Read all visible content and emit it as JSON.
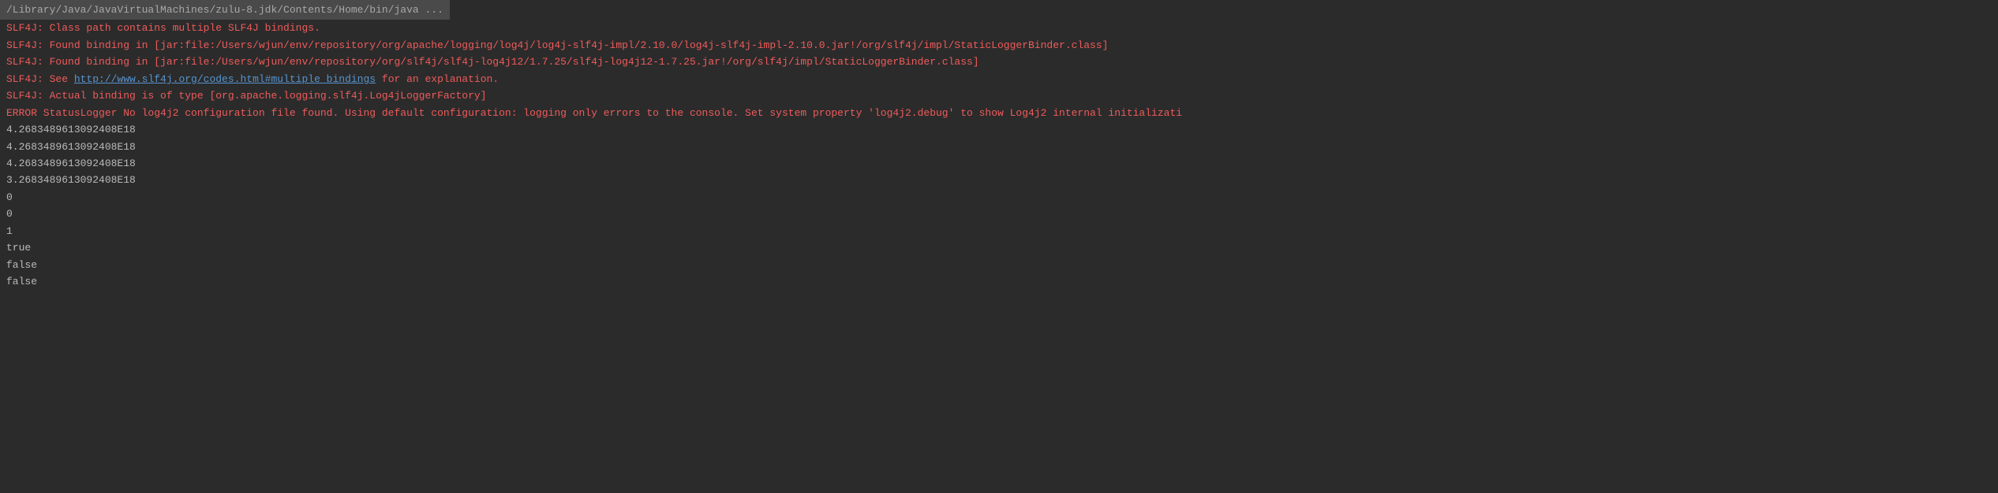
{
  "header": {
    "command": "/Library/Java/JavaVirtualMachines/zulu-8.jdk/Contents/Home/bin/java ..."
  },
  "lines": [
    {
      "type": "error",
      "text": "SLF4J: Class path contains multiple SLF4J bindings."
    },
    {
      "type": "error",
      "text": "SLF4J: Found binding in [jar:file:/Users/wjun/env/repository/org/apache/logging/log4j/log4j-slf4j-impl/2.10.0/log4j-slf4j-impl-2.10.0.jar!/org/slf4j/impl/StaticLoggerBinder.class]"
    },
    {
      "type": "error",
      "text": "SLF4J: Found binding in [jar:file:/Users/wjun/env/repository/org/slf4j/slf4j-log4j12/1.7.25/slf4j-log4j12-1.7.25.jar!/org/slf4j/impl/StaticLoggerBinder.class]"
    },
    {
      "type": "error-with-link",
      "prefix": "SLF4J: See ",
      "link": "http://www.slf4j.org/codes.html#multiple_bindings",
      "suffix": " for an explanation."
    },
    {
      "type": "error",
      "text": "SLF4J: Actual binding is of type [org.apache.logging.slf4j.Log4jLoggerFactory]"
    },
    {
      "type": "error",
      "text": "ERROR StatusLogger No log4j2 configuration file found. Using default configuration: logging only errors to the console. Set system property 'log4j2.debug' to show Log4j2 internal initializati"
    },
    {
      "type": "output",
      "text": "4.2683489613092408E18"
    },
    {
      "type": "output",
      "text": "4.2683489613092408E18"
    },
    {
      "type": "output",
      "text": "4.2683489613092408E18"
    },
    {
      "type": "output",
      "text": "3.2683489613092408E18"
    },
    {
      "type": "output",
      "text": "0"
    },
    {
      "type": "output",
      "text": "0"
    },
    {
      "type": "output",
      "text": "1"
    },
    {
      "type": "output",
      "text": "true"
    },
    {
      "type": "output",
      "text": "false"
    },
    {
      "type": "output",
      "text": "false"
    }
  ]
}
